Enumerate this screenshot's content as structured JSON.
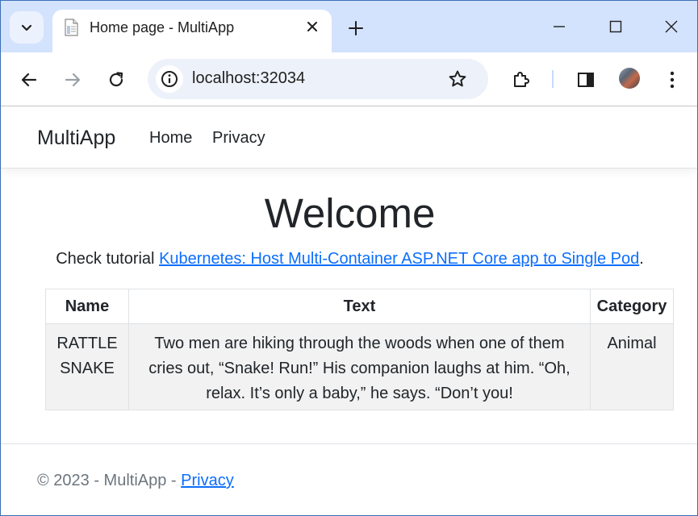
{
  "browser": {
    "tab_title": "Home page - MultiApp",
    "url": "localhost:32034",
    "accent_color": "#d3e3fd"
  },
  "icons": {
    "tab_search": "chevron-down-icon",
    "favicon": "document-icon",
    "close": "close-icon",
    "new_tab": "plus-icon",
    "minimize": "minimize-icon",
    "maximize": "maximize-icon",
    "window_close": "close-icon",
    "back": "arrow-left-icon",
    "forward": "arrow-right-icon",
    "reload": "reload-icon",
    "site_info": "info-icon",
    "bookmark": "star-icon",
    "extensions": "puzzle-icon",
    "side_panel": "side-panel-icon",
    "menu": "kebab-menu-icon"
  },
  "navbar": {
    "brand": "MultiApp",
    "links": [
      "Home",
      "Privacy"
    ]
  },
  "main": {
    "heading": "Welcome",
    "tutorial_prefix": "Check tutorial ",
    "tutorial_link": "Kubernetes: Host Multi-Container ASP.NET Core app to Single Pod",
    "tutorial_suffix": ".",
    "table": {
      "headers": [
        "Name",
        "Text",
        "Category"
      ],
      "rows": [
        {
          "name": "RATTLE SNAKE",
          "text": "Two men are hiking through the woods when one of them cries out, “Snake! Run!” His companion laughs at him. “Oh, relax. It’s only a baby,” he says. “Don’t you!",
          "category": "Animal"
        }
      ]
    }
  },
  "footer": {
    "text": "© 2023 - MultiApp - ",
    "link": "Privacy"
  }
}
